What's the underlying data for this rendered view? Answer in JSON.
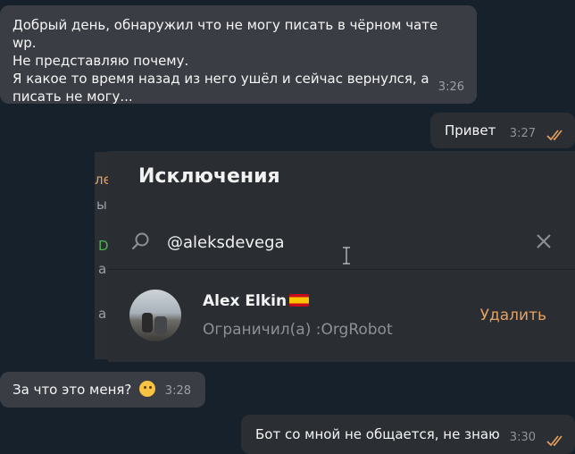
{
  "messages": [
    {
      "text": "Добрый день, обнаружил что не могу писать в чёрном чате wp.\nНе представляю почему.\nЯ какое то время назад из него ушёл и сейчас вернулся, а\nписать не могу...",
      "time": "3:26"
    },
    {
      "text": "Привет",
      "time": "3:27"
    },
    {
      "text": "За что это меня?",
      "time": "3:28"
    },
    {
      "text": "Бот со мной не общается, не знаю",
      "time": "3:30"
    }
  ],
  "background_fragments": [
    "ле",
    "ы",
    "D",
    "а",
    "а"
  ],
  "dialog": {
    "title": "Исключения",
    "search": {
      "value": "@aleksdevega"
    },
    "result": {
      "name": "Alex Elkin",
      "status": "Ограничил(а) :OrgRobot",
      "action_label": "Удалить"
    }
  },
  "colors": {
    "accent": "#e6a05f",
    "check_ticks": "#e6a05f",
    "dialog_bg": "#2a2e33",
    "chat_bg": "#17212b"
  },
  "icons": [
    "search-icon",
    "clear-icon",
    "double-check-icon",
    "thinking-face-emoji",
    "spain-flag-icon"
  ]
}
